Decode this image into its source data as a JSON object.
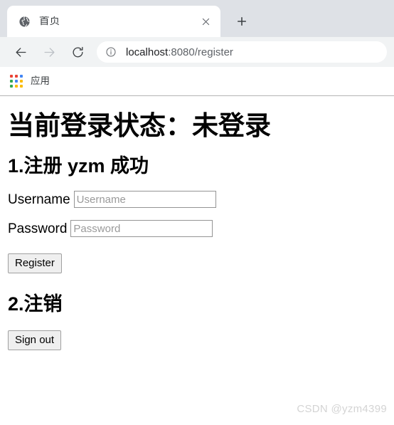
{
  "browser": {
    "tab": {
      "title": "首页",
      "favicon_icon": "globe-icon",
      "close_icon": "close-icon"
    },
    "new_tab_icon": "plus-icon",
    "nav": {
      "back_icon": "back-arrow-icon",
      "forward_icon": "forward-arrow-icon",
      "reload_icon": "reload-icon"
    },
    "omnibox": {
      "info_icon": "info-circle-icon",
      "url_host": "localhost",
      "url_rest": ":8080/register",
      "full_url": "localhost:8080/register"
    },
    "bookmarks": [
      {
        "label": "应用",
        "icon": "apps-grid-icon",
        "grid_colors": [
          "#ea4335",
          "#ea4335",
          "#4285f4",
          "#34a853",
          "#4285f4",
          "#fbbc05",
          "#34a853",
          "#fbbc05",
          "#fbbc05"
        ]
      }
    ]
  },
  "page": {
    "status_heading": "当前登录状态：未登录",
    "section_register_heading": "1.注册 yzm 成功",
    "form": {
      "username_label": "Username",
      "username_placeholder": "Username",
      "username_value": "",
      "password_label": "Password",
      "password_placeholder": "Password",
      "password_value": "",
      "register_button": "Register"
    },
    "section_signout_heading": "2.注销",
    "signout_button": "Sign out",
    "watermark": "CSDN @yzm4399"
  },
  "colors": {
    "tab_strip": "#dee1e6",
    "toolbar": "#f1f3f4",
    "tab_active": "#ffffff",
    "text_primary": "#202124",
    "text_secondary": "#5f6368",
    "watermark": "#d4d4d4"
  }
}
